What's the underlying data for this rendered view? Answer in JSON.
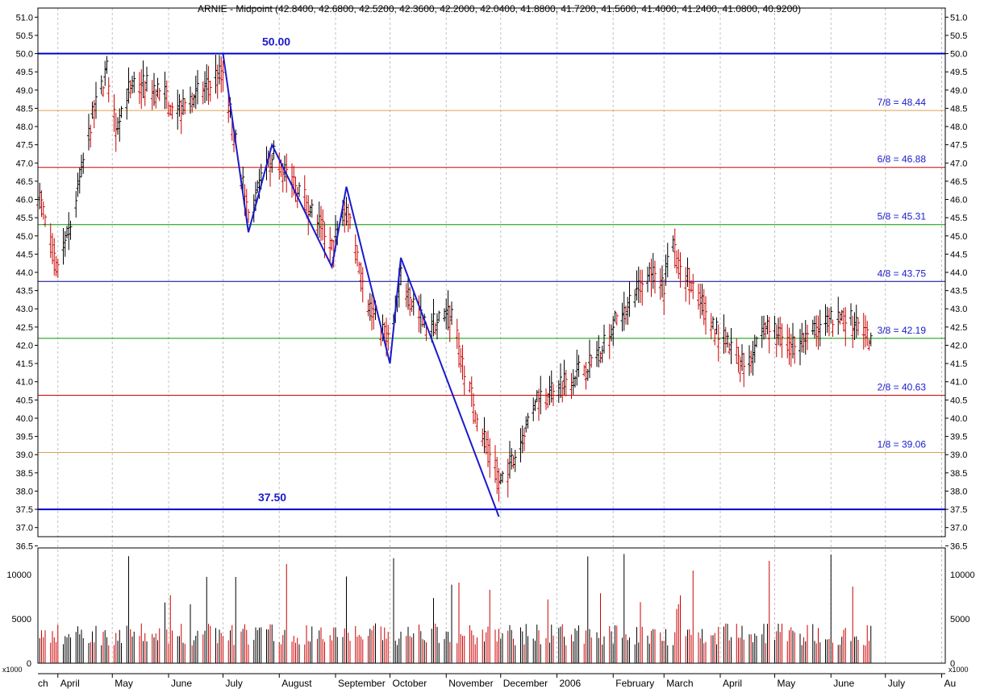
{
  "chart_data": {
    "type": "ohlc",
    "title": "ARNIE - Midpoint (42.8400, 42.6800, 42.5200, 42.3600, 42.2000, 42.0400, 41.8800, 41.7200, 41.5600, 41.4000, 41.2400, 41.0800, 40.9200)",
    "axis_symbols": {
      "volume_multiplier": "x1000"
    },
    "price_axis": {
      "range": [
        36.75,
        51.25
      ],
      "ticks": [
        "51.0",
        "50.5",
        "50.0",
        "49.5",
        "49.0",
        "48.5",
        "48.0",
        "47.5",
        "47.0",
        "46.5",
        "46.0",
        "45.5",
        "45.0",
        "44.5",
        "44.0",
        "43.5",
        "43.0",
        "42.5",
        "42.0",
        "41.5",
        "41.0",
        "40.5",
        "40.0",
        "39.5",
        "39.0",
        "38.5",
        "38.0",
        "37.5",
        "37.0",
        "36.5"
      ]
    },
    "volume_axis": {
      "range": [
        0,
        13000
      ],
      "ticks": [
        "10000",
        "5000",
        "0"
      ],
      "unit": "x1000"
    },
    "time_axis": {
      "labels": [
        "ch",
        "April",
        "May",
        "June",
        "July",
        "August",
        "September",
        "October",
        "November",
        "December",
        "2006",
        "February",
        "March",
        "April",
        "May",
        "June",
        "July",
        "Au"
      ]
    },
    "murrey_lines": [
      {
        "label": "",
        "value": 50.0,
        "color": "#0000cc",
        "bold": true,
        "tag": "50.00"
      },
      {
        "label": "7/8 = 48.44",
        "value": 48.44,
        "color": "#e0a050"
      },
      {
        "label": "6/8 = 46.88",
        "value": 46.88,
        "color": "#cc0000"
      },
      {
        "label": "5/8 = 45.31",
        "value": 45.31,
        "color": "#009900"
      },
      {
        "label": "4/8 = 43.75",
        "value": 43.75,
        "color": "#000088"
      },
      {
        "label": "3/8 = 42.19",
        "value": 42.19,
        "color": "#009900"
      },
      {
        "label": "2/8 = 40.63",
        "value": 40.63,
        "color": "#cc0000"
      },
      {
        "label": "1/8 = 39.06",
        "value": 39.06,
        "color": "#e0a050"
      },
      {
        "label": "",
        "value": 37.5,
        "color": "#0000cc",
        "bold": true,
        "tag": "37.50"
      }
    ],
    "zigzag": {
      "color": "#1a1acc",
      "points": [
        [
          "2005-07-01",
          50.0
        ],
        [
          "2005-07-15",
          45.1
        ],
        [
          "2005-07-28",
          47.5
        ],
        [
          "2005-08-30",
          44.15
        ],
        [
          "2005-09-07",
          46.35
        ],
        [
          "2005-10-01",
          41.5
        ],
        [
          "2005-10-07",
          44.4
        ],
        [
          "2005-11-30",
          37.3
        ]
      ]
    },
    "price_series_note": "",
    "volume": {
      "ticks_plotted_from": "2005-03-21",
      "values": []
    },
    "grid": true,
    "colors": {
      "up": "#000000",
      "down": "#cc0000",
      "label_text": "#1a1acc",
      "grid": "#c0c0c0"
    }
  }
}
